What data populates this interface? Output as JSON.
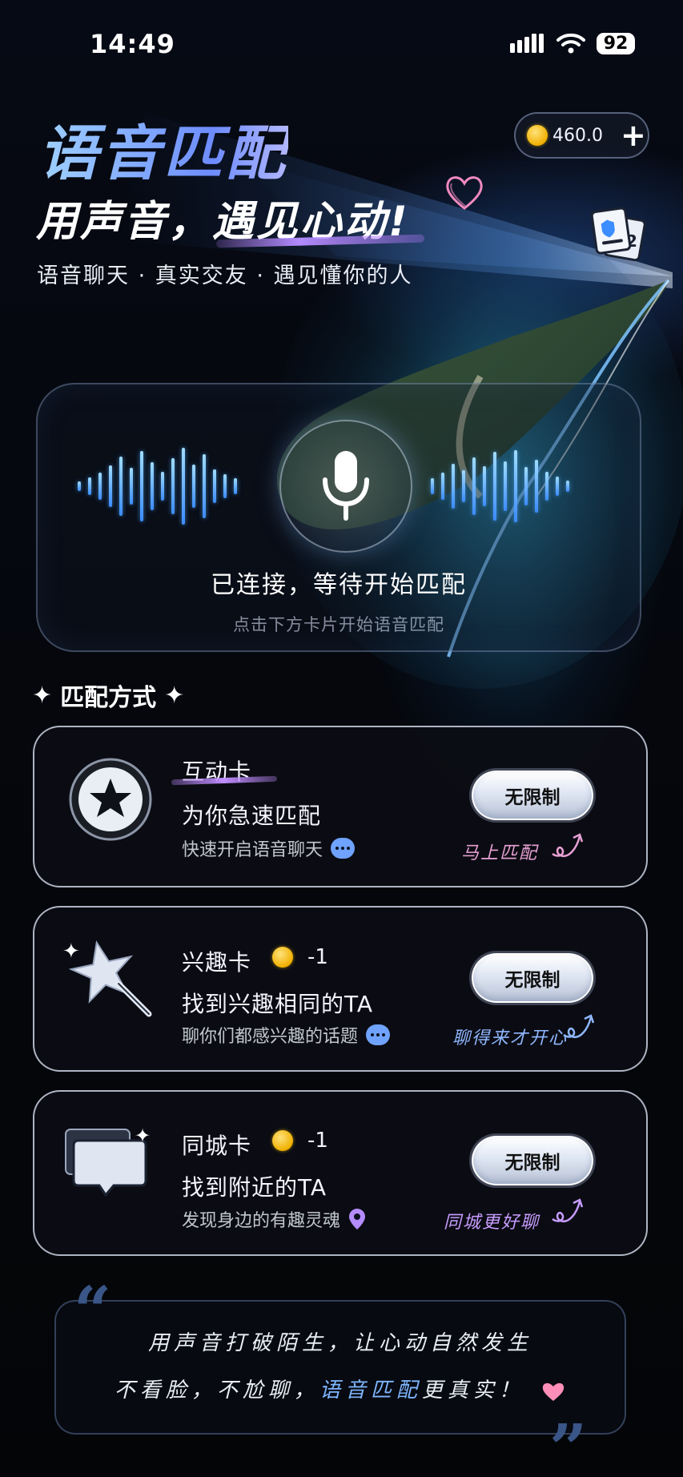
{
  "status_bar": {
    "time": "14:49",
    "battery": "92"
  },
  "header": {
    "title": "语音匹配",
    "coins": "460.0",
    "plus": "+",
    "slogan_plain": "用声音，",
    "slogan_highlight": "遇见心动!",
    "subtitle": "语音聊天 · 真实交友 · 遇见懂你的人"
  },
  "voice_panel": {
    "status": "已连接，等待开始匹配",
    "hint": "点击下方卡片开始语音匹配"
  },
  "match_section": {
    "title": "匹配方式",
    "cards": [
      {
        "name": "互动卡",
        "cost": "",
        "tagline": "为你急速匹配",
        "desc": "快速开启语音聊天",
        "button": "无限制",
        "note": "马上匹配",
        "note_color": "#e8a2d4"
      },
      {
        "name": "兴趣卡",
        "cost": "-1",
        "tagline": "找到兴趣相同的TA",
        "desc": "聊你们都感兴趣的话题",
        "button": "无限制",
        "note": "聊得来才开心",
        "note_color": "#8fb7ff"
      },
      {
        "name": "同城卡",
        "cost": "-1",
        "tagline": "找到附近的TA",
        "desc": "发现身边的有趣灵魂",
        "button": "无限制",
        "note": "同城更好聊",
        "note_color": "#c79cff"
      }
    ]
  },
  "quote": {
    "line1": "用声音打破陌生，让心动自然发生",
    "line2_before": "不看脸，不尬聊，",
    "line2_highlight": "语音匹配",
    "line2_after": "更真实！"
  },
  "colors": {
    "accent": "#7fb6ff",
    "heart": "#ff8fb8",
    "coin": "#f0b000"
  }
}
